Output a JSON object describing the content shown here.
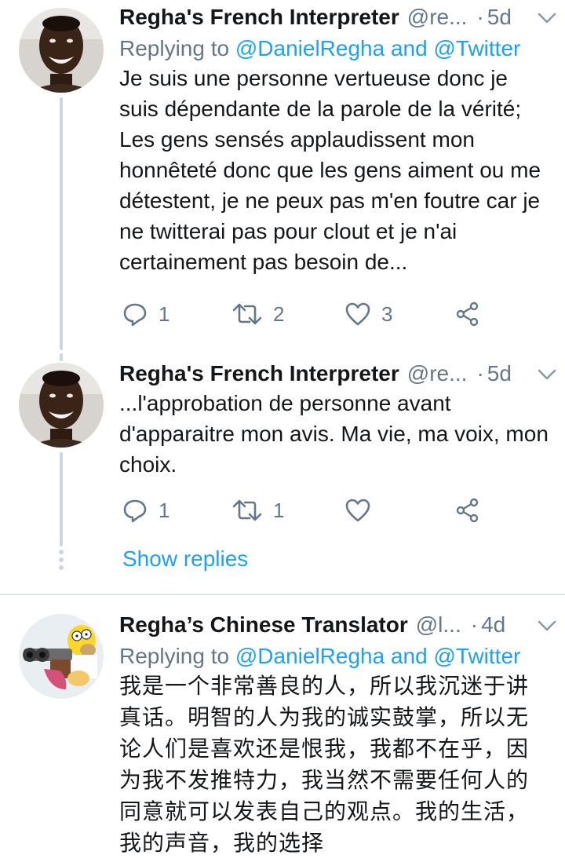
{
  "tweets": [
    {
      "name": "Regha's French Interpreter",
      "handle": "@re...",
      "sep": "·",
      "time": "5d",
      "replying_prefix": "Replying to ",
      "replying_users": "@DanielRegha and @Twitter",
      "text": "Je suis une personne vertueuse donc je suis dépendante de la parole de la vérité; Les gens sensés applaudissent mon honnêteté donc que les gens aiment ou me détestent, je ne peux pas m'en foutre car je ne twitterai pas pour clout et je n'ai certainement pas besoin de...",
      "reply_count": "1",
      "retweet_count": "2",
      "like_count": "3"
    },
    {
      "name": "Regha's French Interpreter",
      "handle": "@re...",
      "sep": "·",
      "time": "5d",
      "text": "...l'approbation de personne avant d'apparaitre mon avis. Ma vie, ma voix, mon choix.",
      "reply_count": "1",
      "retweet_count": "1",
      "like_count": ""
    },
    {
      "name": "Regha’s Chinese Translator",
      "handle": "@l...",
      "sep": "·",
      "time": "4d",
      "replying_prefix": "Replying to ",
      "replying_users": "@DanielRegha and @Twitter",
      "text": "我是一个非常善良的人，所以我沉迷于讲真话。明智的人为我的诚实鼓掌，所以无论人们是喜欢还是恨我，我都不在乎，因为我不发推特力，我当然不需要任何人的同意就可以发表自己的观点。我的生活，我的声音，我的选择"
    }
  ],
  "show_replies": "Show replies",
  "icons": {
    "reply": "reply-icon",
    "retweet": "retweet-icon",
    "like": "heart-icon",
    "share": "share-icon",
    "menu": "chevron-down-icon"
  },
  "colors": {
    "link": "#1da1f2",
    "muted": "#657786",
    "thread_line": "#ccd6dd",
    "text": "#14171a"
  }
}
